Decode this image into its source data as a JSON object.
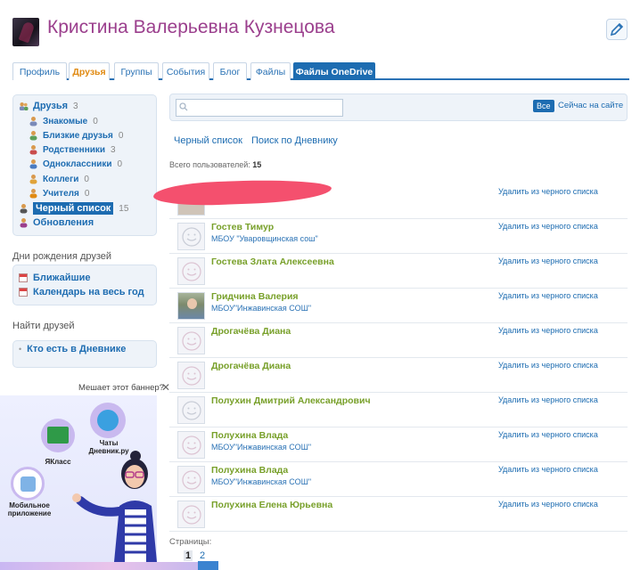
{
  "profile": {
    "name": "Кристина Валерьевна Кузнецова"
  },
  "tabs": [
    {
      "label": "Профиль"
    },
    {
      "label": "Друзья"
    },
    {
      "label": "Группы"
    },
    {
      "label": "События"
    },
    {
      "label": "Блог"
    },
    {
      "label": "Файлы"
    },
    {
      "label": "Файлы OneDrive"
    }
  ],
  "friends_nav": {
    "friends": {
      "label": "Друзья",
      "count": "3"
    },
    "items": [
      {
        "label": "Знакомые",
        "count": "0"
      },
      {
        "label": "Близкие друзья",
        "count": "0"
      },
      {
        "label": "Родственники",
        "count": "3"
      },
      {
        "label": "Одноклассники",
        "count": "0"
      },
      {
        "label": "Коллеги",
        "count": "0"
      },
      {
        "label": "Учителя",
        "count": "0"
      }
    ],
    "blacklist": {
      "label": "Черный список",
      "count": "15"
    },
    "updates": {
      "label": "Обновления"
    }
  },
  "birthdays": {
    "title": "Дни рождения друзей",
    "items": [
      {
        "label": "Ближайшие"
      },
      {
        "label": "Календарь на весь год"
      }
    ]
  },
  "find_friends": {
    "title": "Найти друзей",
    "link": "Кто есть в Дневнике"
  },
  "banner": {
    "question": "Мешает этот баннер?",
    "apps": [
      {
        "label": "ЯКласс"
      },
      {
        "label": "Чаты Дневник.ру"
      },
      {
        "label": "Мобильное приложение"
      }
    ]
  },
  "search": {
    "placeholder": "",
    "all_label": "Все",
    "online_label": "Сейчас на сайте"
  },
  "subtabs": [
    "Черный список",
    "Поиск по Дневнику"
  ],
  "total": {
    "label": "Всего пользователей:",
    "value": "15"
  },
  "remove_label": "Удалить из черного списка",
  "users": [
    {
      "name": "",
      "school": ""
    },
    {
      "name": "Гостев Тимур",
      "school": "МБОУ \"Уваровщинская сош\""
    },
    {
      "name": "Гостева Злата Алексеевна",
      "school": ""
    },
    {
      "name": "Гридчина Валерия",
      "school": "МБОУ\"Инжавинская СОШ\""
    },
    {
      "name": "Дрогачёва Диана",
      "school": ""
    },
    {
      "name": "Дрогачёва Диана",
      "school": ""
    },
    {
      "name": "Полухин Дмитрий Александрович",
      "school": ""
    },
    {
      "name": "Полухина Влада",
      "school": "МБОУ\"Инжавинская СОШ\""
    },
    {
      "name": "Полухина Влада",
      "school": "МБОУ\"Инжавинская СОШ\""
    },
    {
      "name": "Полухина Елена Юрьевна",
      "school": ""
    }
  ],
  "pagination": {
    "label": "Страницы:",
    "pages": [
      "1",
      "2"
    ]
  }
}
